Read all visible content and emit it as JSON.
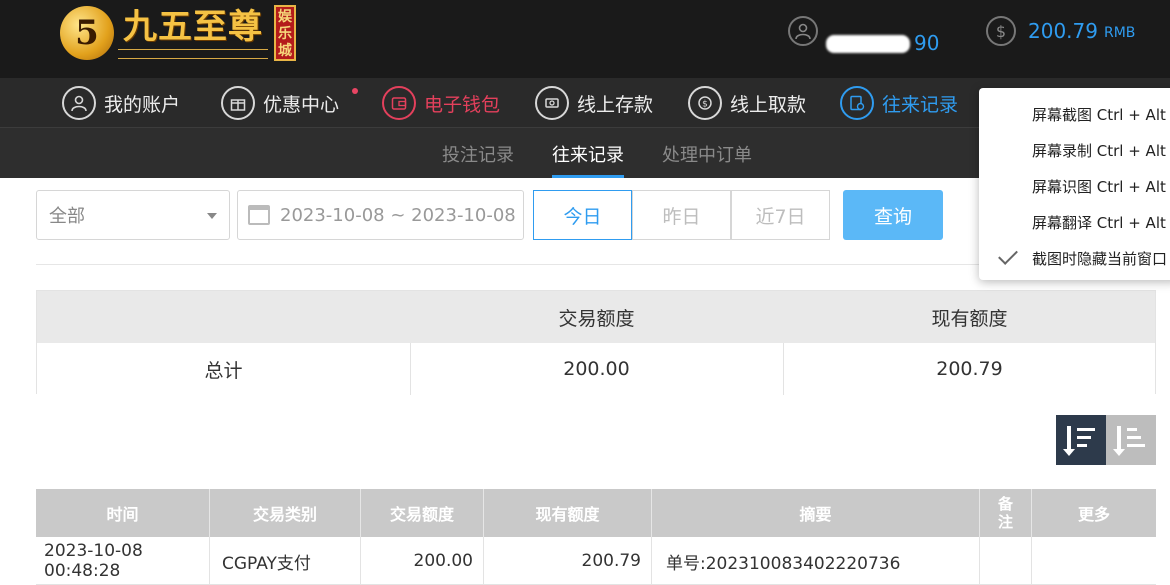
{
  "logo": {
    "circle": "5",
    "name": "九五至尊",
    "badge": "娱乐城"
  },
  "header": {
    "username_tail": "90",
    "balance": "200.79",
    "currency": "RMB"
  },
  "nav": {
    "items": [
      {
        "label": "我的账户",
        "icon": "user-icon"
      },
      {
        "label": "优惠中心",
        "icon": "gift-icon"
      },
      {
        "label": "电子钱包",
        "icon": "wallet-icon"
      },
      {
        "label": "线上存款",
        "icon": "deposit-icon"
      },
      {
        "label": "线上取款",
        "icon": "withdraw-icon"
      },
      {
        "label": "往来记录",
        "icon": "records-icon"
      }
    ],
    "colors": {
      "active": "#2f9cf0",
      "wallet": "#e4405c",
      "dot": "#e84563"
    }
  },
  "subnav": {
    "tabs": [
      "投注记录",
      "往来记录",
      "处理中订单"
    ],
    "active": "往来记录"
  },
  "filters": {
    "type_selected": "全部",
    "date_range": "2023-10-08 ~ 2023-10-08",
    "quick": [
      "今日",
      "昨日",
      "近7日"
    ],
    "query_label": "查询"
  },
  "summary": {
    "headers": [
      "交易额度",
      "现有额度"
    ],
    "row_label": "总计",
    "trade_amount": "200.00",
    "current_amount": "200.79"
  },
  "records": {
    "headers": [
      "时间",
      "交易类别",
      "交易额度",
      "现有额度",
      "摘要",
      "备注",
      "更多"
    ],
    "rows": [
      {
        "time": "2023-10-08 00:48:28",
        "type": "CGPAY支付",
        "amount": "200.00",
        "balance": "200.79",
        "summary": "单号:202310083402220736",
        "note": "",
        "more": ""
      }
    ]
  },
  "context_menu": {
    "items": [
      "屏幕截图 Ctrl + Alt +",
      "屏幕录制 Ctrl + Alt +",
      "屏幕识图 Ctrl + Alt +",
      "屏幕翻译 Ctrl + Alt +",
      "截图时隐藏当前窗口"
    ]
  }
}
